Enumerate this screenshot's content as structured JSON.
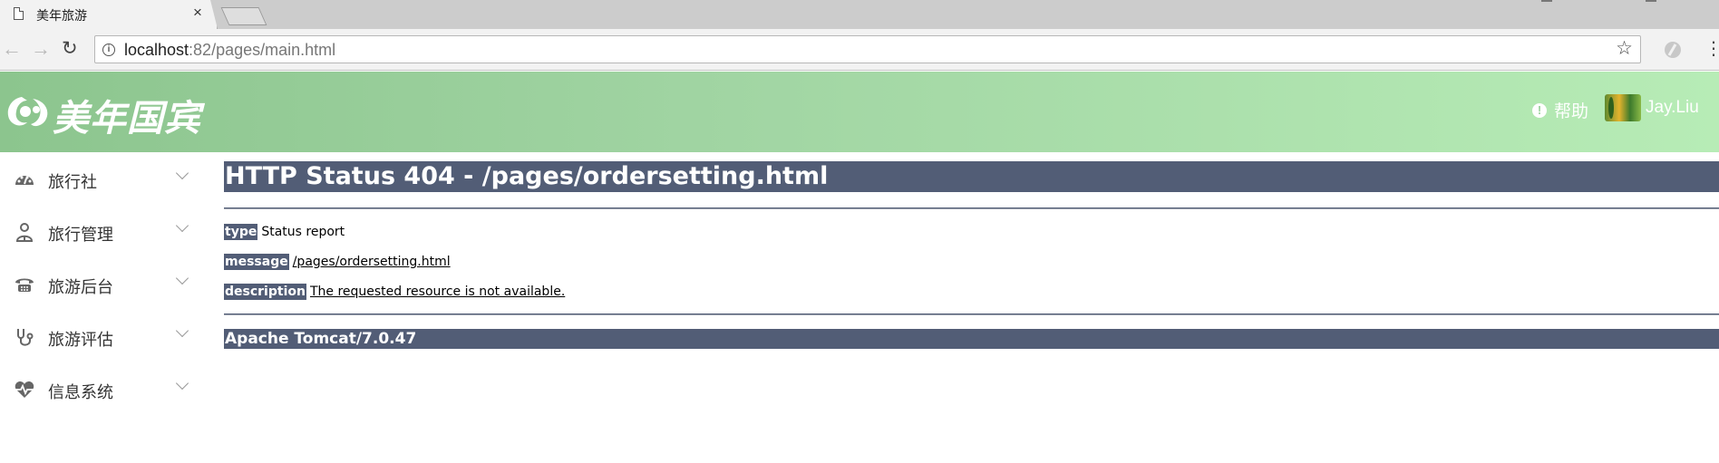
{
  "browser": {
    "tab_title": "美年旅游",
    "tab_close": "×",
    "url_host": "localhost",
    "url_rest": ":82/pages/main.html"
  },
  "header": {
    "logo_text": "美年国宾",
    "help_label": "帮助",
    "help_icon": "!",
    "username": "Jay.Liu"
  },
  "sidebar": {
    "items": [
      {
        "label": "旅行社",
        "icon": "dashboard-icon"
      },
      {
        "label": "旅行管理",
        "icon": "user-icon"
      },
      {
        "label": "旅游后台",
        "icon": "phone-icon"
      },
      {
        "label": "旅游评估",
        "icon": "stethoscope-icon"
      },
      {
        "label": "信息系统",
        "icon": "heartbeat-icon"
      }
    ]
  },
  "error_page": {
    "title": "HTTP Status 404 - /pages/ordersetting.html",
    "type_label": "type",
    "type_value": "Status report",
    "message_label": "message",
    "message_value": "/pages/ordersetting.html",
    "description_label": "description",
    "description_value": "The requested resource is not available.",
    "server": "Apache Tomcat/7.0.47",
    "accent_color": "#525d76"
  }
}
